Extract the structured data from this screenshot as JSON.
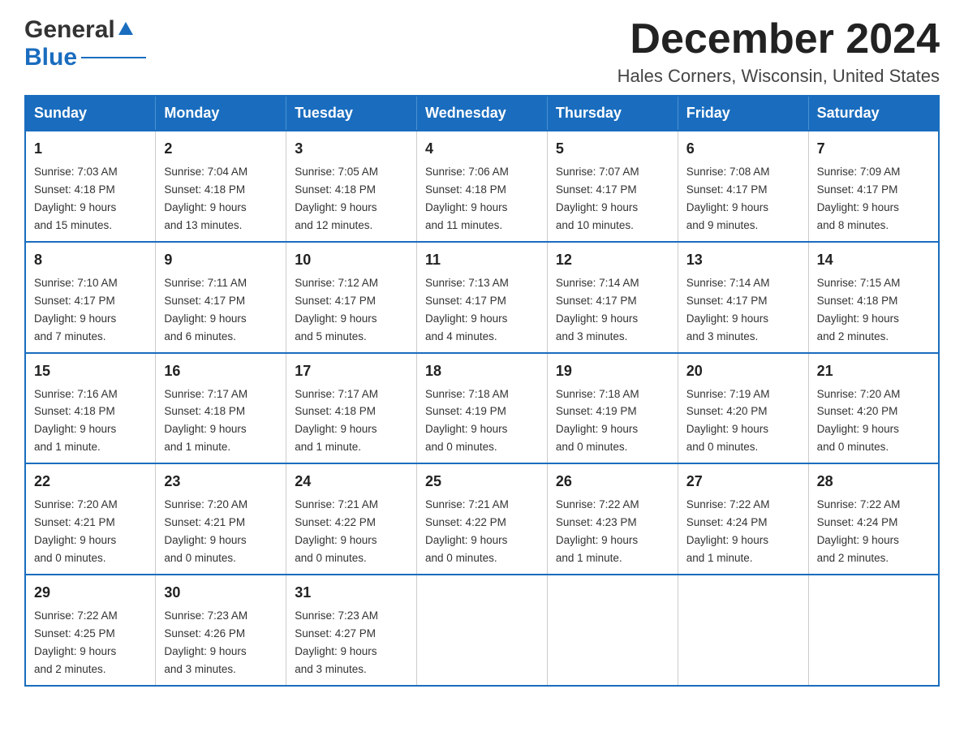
{
  "header": {
    "logo_general": "General",
    "logo_blue": "Blue",
    "month_year": "December 2024",
    "location": "Hales Corners, Wisconsin, United States"
  },
  "days_of_week": [
    "Sunday",
    "Monday",
    "Tuesday",
    "Wednesday",
    "Thursday",
    "Friday",
    "Saturday"
  ],
  "weeks": [
    [
      {
        "day": "1",
        "sunrise": "7:03 AM",
        "sunset": "4:18 PM",
        "daylight": "9 hours and 15 minutes."
      },
      {
        "day": "2",
        "sunrise": "7:04 AM",
        "sunset": "4:18 PM",
        "daylight": "9 hours and 13 minutes."
      },
      {
        "day": "3",
        "sunrise": "7:05 AM",
        "sunset": "4:18 PM",
        "daylight": "9 hours and 12 minutes."
      },
      {
        "day": "4",
        "sunrise": "7:06 AM",
        "sunset": "4:18 PM",
        "daylight": "9 hours and 11 minutes."
      },
      {
        "day": "5",
        "sunrise": "7:07 AM",
        "sunset": "4:17 PM",
        "daylight": "9 hours and 10 minutes."
      },
      {
        "day": "6",
        "sunrise": "7:08 AM",
        "sunset": "4:17 PM",
        "daylight": "9 hours and 9 minutes."
      },
      {
        "day": "7",
        "sunrise": "7:09 AM",
        "sunset": "4:17 PM",
        "daylight": "9 hours and 8 minutes."
      }
    ],
    [
      {
        "day": "8",
        "sunrise": "7:10 AM",
        "sunset": "4:17 PM",
        "daylight": "9 hours and 7 minutes."
      },
      {
        "day": "9",
        "sunrise": "7:11 AM",
        "sunset": "4:17 PM",
        "daylight": "9 hours and 6 minutes."
      },
      {
        "day": "10",
        "sunrise": "7:12 AM",
        "sunset": "4:17 PM",
        "daylight": "9 hours and 5 minutes."
      },
      {
        "day": "11",
        "sunrise": "7:13 AM",
        "sunset": "4:17 PM",
        "daylight": "9 hours and 4 minutes."
      },
      {
        "day": "12",
        "sunrise": "7:14 AM",
        "sunset": "4:17 PM",
        "daylight": "9 hours and 3 minutes."
      },
      {
        "day": "13",
        "sunrise": "7:14 AM",
        "sunset": "4:17 PM",
        "daylight": "9 hours and 3 minutes."
      },
      {
        "day": "14",
        "sunrise": "7:15 AM",
        "sunset": "4:18 PM",
        "daylight": "9 hours and 2 minutes."
      }
    ],
    [
      {
        "day": "15",
        "sunrise": "7:16 AM",
        "sunset": "4:18 PM",
        "daylight": "9 hours and 1 minute."
      },
      {
        "day": "16",
        "sunrise": "7:17 AM",
        "sunset": "4:18 PM",
        "daylight": "9 hours and 1 minute."
      },
      {
        "day": "17",
        "sunrise": "7:17 AM",
        "sunset": "4:18 PM",
        "daylight": "9 hours and 1 minute."
      },
      {
        "day": "18",
        "sunrise": "7:18 AM",
        "sunset": "4:19 PM",
        "daylight": "9 hours and 0 minutes."
      },
      {
        "day": "19",
        "sunrise": "7:18 AM",
        "sunset": "4:19 PM",
        "daylight": "9 hours and 0 minutes."
      },
      {
        "day": "20",
        "sunrise": "7:19 AM",
        "sunset": "4:20 PM",
        "daylight": "9 hours and 0 minutes."
      },
      {
        "day": "21",
        "sunrise": "7:20 AM",
        "sunset": "4:20 PM",
        "daylight": "9 hours and 0 minutes."
      }
    ],
    [
      {
        "day": "22",
        "sunrise": "7:20 AM",
        "sunset": "4:21 PM",
        "daylight": "9 hours and 0 minutes."
      },
      {
        "day": "23",
        "sunrise": "7:20 AM",
        "sunset": "4:21 PM",
        "daylight": "9 hours and 0 minutes."
      },
      {
        "day": "24",
        "sunrise": "7:21 AM",
        "sunset": "4:22 PM",
        "daylight": "9 hours and 0 minutes."
      },
      {
        "day": "25",
        "sunrise": "7:21 AM",
        "sunset": "4:22 PM",
        "daylight": "9 hours and 0 minutes."
      },
      {
        "day": "26",
        "sunrise": "7:22 AM",
        "sunset": "4:23 PM",
        "daylight": "9 hours and 1 minute."
      },
      {
        "day": "27",
        "sunrise": "7:22 AM",
        "sunset": "4:24 PM",
        "daylight": "9 hours and 1 minute."
      },
      {
        "day": "28",
        "sunrise": "7:22 AM",
        "sunset": "4:24 PM",
        "daylight": "9 hours and 2 minutes."
      }
    ],
    [
      {
        "day": "29",
        "sunrise": "7:22 AM",
        "sunset": "4:25 PM",
        "daylight": "9 hours and 2 minutes."
      },
      {
        "day": "30",
        "sunrise": "7:23 AM",
        "sunset": "4:26 PM",
        "daylight": "9 hours and 3 minutes."
      },
      {
        "day": "31",
        "sunrise": "7:23 AM",
        "sunset": "4:27 PM",
        "daylight": "9 hours and 3 minutes."
      },
      null,
      null,
      null,
      null
    ]
  ],
  "labels": {
    "sunrise": "Sunrise:",
    "sunset": "Sunset:",
    "daylight": "Daylight:"
  }
}
